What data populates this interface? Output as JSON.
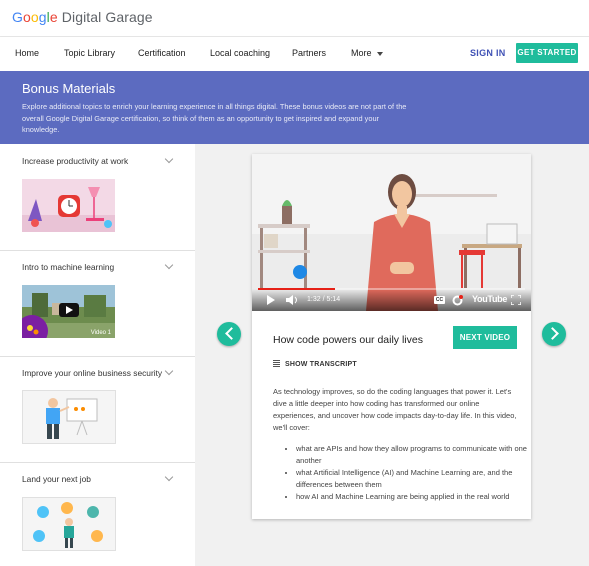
{
  "brand": {
    "google": "Google",
    "product": "Digital Garage"
  },
  "nav": {
    "items": [
      "Home",
      "Topic Library",
      "Certification",
      "Local coaching",
      "Partners",
      "More"
    ],
    "sign_in": "SIGN IN",
    "get_started": "GET STARTED"
  },
  "banner": {
    "title": "Bonus Materials",
    "text": "Explore additional topics to enrich your learning experience in all things digital. These bonus videos are not part of the overall Google Digital Garage certification, so think of them as an opportunity to get inspired and expand your knowledge."
  },
  "sidebar": {
    "items": [
      {
        "label": "Increase productivity at work"
      },
      {
        "label": "Intro to machine learning",
        "badge": "Video 1"
      },
      {
        "label": "Improve your online business security"
      },
      {
        "label": "Land your next job"
      }
    ]
  },
  "player": {
    "time": "1:32 / 5:14",
    "progress": 0.29,
    "brand": "YouTube",
    "cc": "CC"
  },
  "video": {
    "title": "How code powers our daily lives",
    "next_label": "NEXT VIDEO",
    "transcript_label": "SHOW TRANSCRIPT",
    "description": "As technology improves, so do the coding languages that power it. Let's dive a little deeper into how coding has transformed our online experiences, and uncover how code impacts day-to-day life. In this video, we'll cover:",
    "bullets": [
      "what are APIs and how they allow programs to communicate with one another",
      "what Artificial Intelligence (AI) and Machine Learning are, and the differences between them",
      "how AI and Machine Learning are being applied in the real world"
    ]
  },
  "colors": {
    "accent": "#1fbc9c",
    "banner": "#5c6bc0",
    "link": "#3f51b5"
  }
}
